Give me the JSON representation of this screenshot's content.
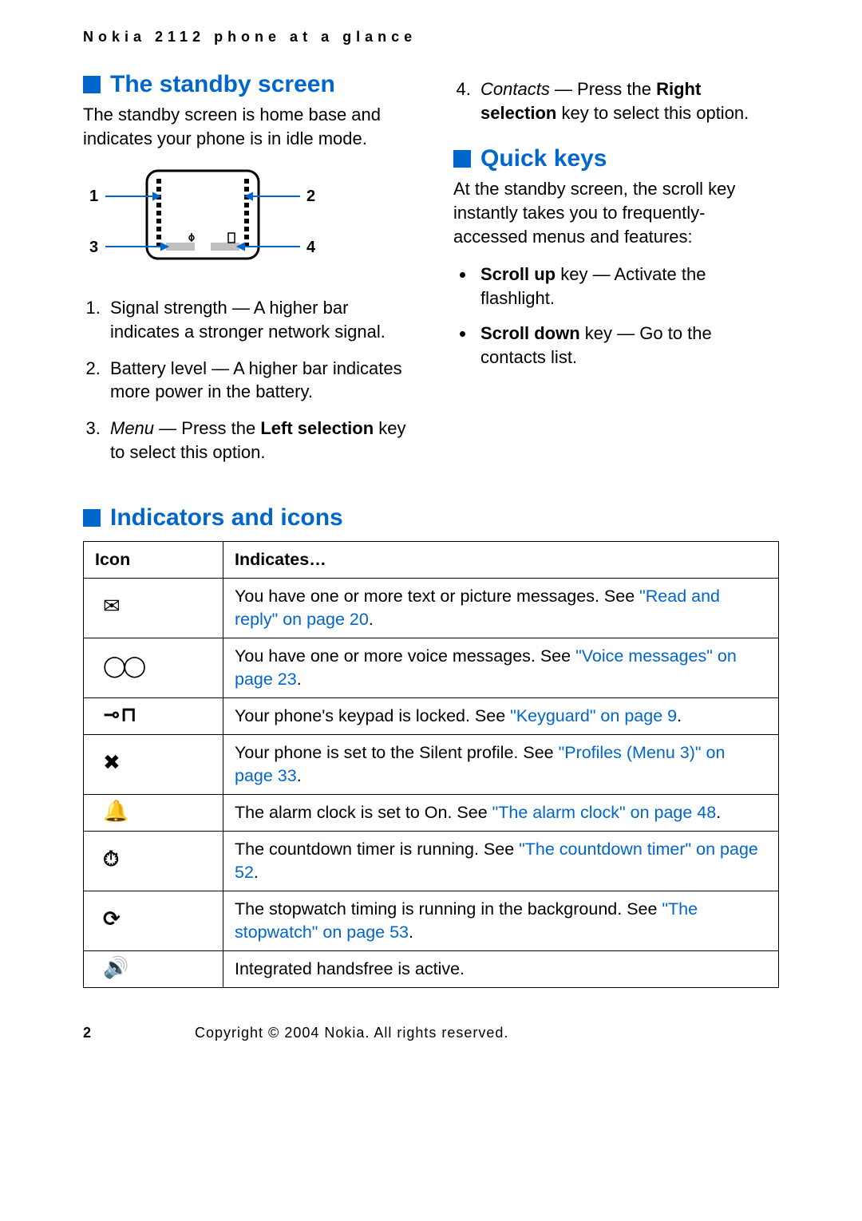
{
  "running_header": "Nokia 2112 phone at a glance",
  "left_col": {
    "standby_title": "The standby screen",
    "standby_intro": "The standby screen is home base and indicates your phone is in idle mode.",
    "diagram_labels": {
      "n1": "1",
      "n2": "2",
      "n3": "3",
      "n4": "4"
    },
    "items": {
      "i1_pre": "Signal strength — A higher bar indicates a stronger network signal.",
      "i2_pre": "Battery level — A higher bar indicates more power in the battery.",
      "i3_em": "Menu",
      "i3_mid": " — Press the ",
      "i3_bold": "Left selection",
      "i3_post": " key to select this option."
    }
  },
  "right_col": {
    "i4_em": "Contacts",
    "i4_mid": " — Press the ",
    "i4_bold": "Right selection",
    "i4_post": " key to select this option.",
    "quick_title": "Quick keys",
    "quick_intro": "At the standby screen, the scroll key instantly takes you to frequently-accessed menus and features:",
    "b1_bold": "Scroll up",
    "b1_rest": " key — Activate the flashlight.",
    "b2_bold": "Scroll down",
    "b2_rest": " key — Go to the contacts list."
  },
  "indicators": {
    "title": "Indicators and icons",
    "th_icon": "Icon",
    "th_ind": "Indicates…",
    "rows": {
      "r1_text": "You have one or more text or picture messages. See ",
      "r1_link": "\"Read and reply\" on page 20",
      "r1_post": ".",
      "r2_text": "You have one or more voice messages. See ",
      "r2_link": "\"Voice messages\" on page 23",
      "r2_post": ".",
      "r3_text": "Your phone's keypad is locked. See ",
      "r3_link": "\"Keyguard\" on page 9",
      "r3_post": ".",
      "r4_text": "Your phone is set to the Silent profile. See ",
      "r4_link": "\"Profiles (Menu 3)\" on page 33",
      "r4_post": ".",
      "r5_text": "The alarm clock is set to On. See ",
      "r5_link": "\"The alarm clock\" on page 48",
      "r5_post": ".",
      "r6_text": "The countdown timer is running. See ",
      "r6_link": "\"The countdown timer\" on page 52",
      "r6_post": ".",
      "r7_text": "The stopwatch timing is running in the background. See ",
      "r7_link": "\"The stopwatch\" on page 53",
      "r7_post": ".",
      "r8_text": "Integrated handsfree is active."
    },
    "icons": {
      "g1": "✉",
      "g2": "◯◯",
      "g3": "⊸⊓",
      "g4": "✖",
      "g5": "🔔",
      "g6": "⏱",
      "g7": "⟳",
      "g8": "🔊"
    }
  },
  "footer": {
    "page": "2",
    "copyright": "Copyright © 2004 Nokia. All rights reserved."
  }
}
